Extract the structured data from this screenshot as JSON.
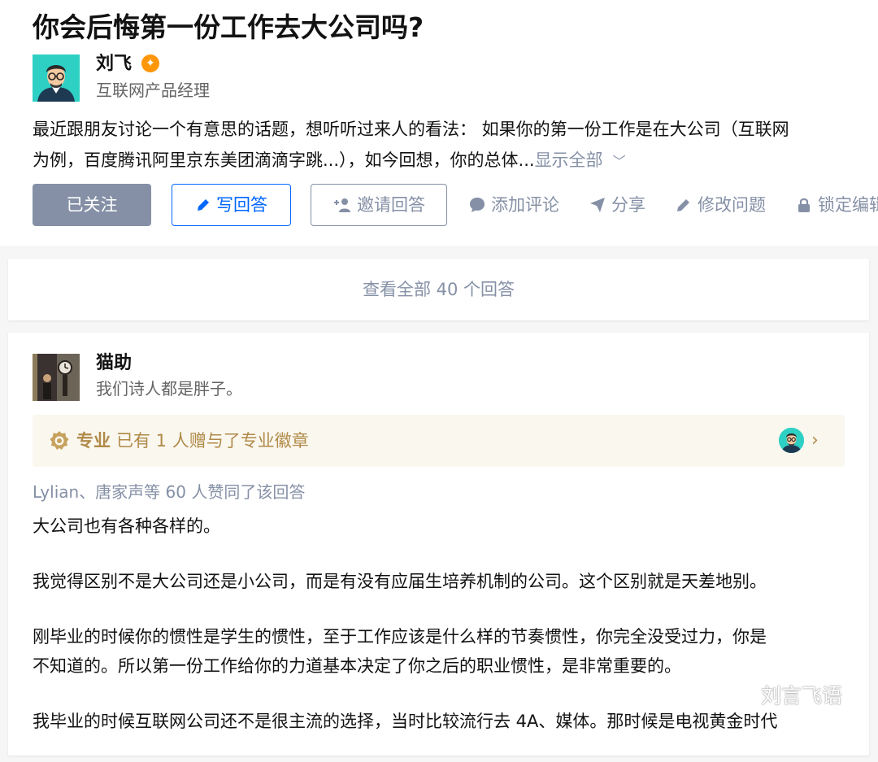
{
  "question": {
    "title": "你会后悔第一份工作去大公司吗?",
    "author_name": "刘飞",
    "author_bio": "互联网产品经理",
    "detail_line1": "最近跟朋友讨论一个有意思的话题，想听听过来人的看法： 如果你的第一份工作是在大公司（互联网",
    "detail_line2": "为例，百度腾讯阿里京东美团滴滴字跳...），如今回想，你的总体...",
    "show_all": "显示全部"
  },
  "actions": {
    "followed": "已关注",
    "write_answer": "写回答",
    "invite": "邀请回答",
    "comment": "添加评论",
    "share": "分享",
    "edit": "修改问题",
    "lock": "锁定编辑"
  },
  "view_all": "查看全部 40 个回答",
  "answer": {
    "author_name": "猫助",
    "author_bio": "我们诗人都是胖子。",
    "pro_label": "专业",
    "pro_text": "已有 1 人赠与了专业徽章",
    "voters": "Lylian、唐家声等 60 人赞同了该回答",
    "paragraphs": {
      "p1": "大公司也有各种各样的。",
      "p2": "我觉得区别不是大公司还是小公司，而是有没有应届生培养机制的公司。这个区别就是天差地别。",
      "p3a": "刚毕业的时候你的惯性是学生的惯性，至于工作应该是什么样的节奏惯性，你完全没受过力，你是",
      "p3b": "不知道的。所以第一份工作给你的力道基本决定了你之后的职业惯性，是非常重要的。",
      "p4": "我毕业的时候互联网公司还不是很主流的选择，当时比较流行去 4A、媒体。那时候是电视黄金时代"
    }
  },
  "watermark": "刘言飞语",
  "colors": {
    "brand_blue": "#0066ff",
    "gray": "#8590a6",
    "pro_gold": "#b08a48",
    "badge_orange": "#ff9607"
  }
}
